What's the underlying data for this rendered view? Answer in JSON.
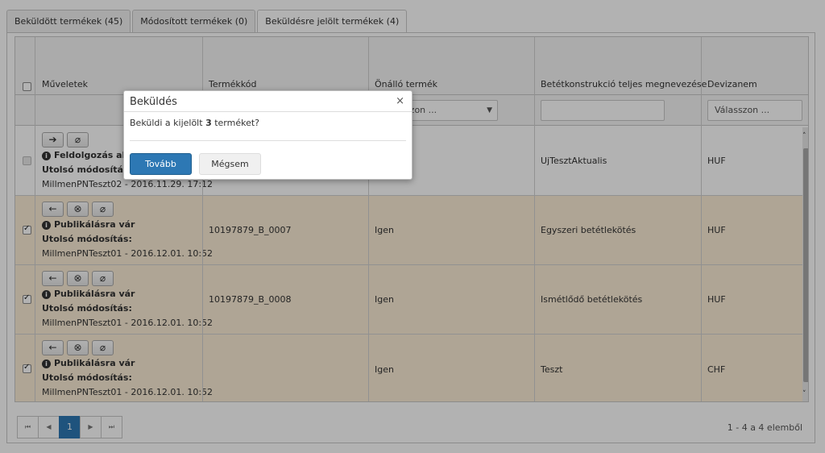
{
  "tabs": [
    {
      "label": "Beküldött termékek (45)"
    },
    {
      "label": "Módosított termékek (0)"
    },
    {
      "label": "Beküldésre jelölt termékek (4)"
    }
  ],
  "columns": {
    "actions": "Műveletek",
    "product_code": "Termékkód",
    "standalone": "Önálló termék",
    "full_name": "Betétkonstrukció teljes megnevezése",
    "currency": "Devizanem"
  },
  "filters": {
    "standalone_select": "Válasszon ...",
    "currency_select": "Válasszon ..."
  },
  "rows": [
    {
      "status": "Feldolgozás alatt",
      "modified_label": "Utolsó módosítás:",
      "modified_by": "MillmenPNTeszt02 - 2016.11.29. 17:12",
      "code": "",
      "standalone": "",
      "name": "UjTesztAktualis",
      "currency": "HUF",
      "checked": false
    },
    {
      "status": "Publikálásra vár",
      "modified_label": "Utolsó módosítás:",
      "modified_by": "MillmenPNTeszt01 - 2016.12.01. 10:52",
      "code": "10197879_B_0007",
      "standalone": "Igen",
      "name": "Egyszeri betétlekötés",
      "currency": "HUF",
      "checked": true
    },
    {
      "status": "Publikálásra vár",
      "modified_label": "Utolsó módosítás:",
      "modified_by": "MillmenPNTeszt01 - 2016.12.01. 10:52",
      "code": "10197879_B_0008",
      "standalone": "Igen",
      "name": "Ismétlődő betétlekötés",
      "currency": "HUF",
      "checked": true
    },
    {
      "status": "Publikálásra vár",
      "modified_label": "Utolsó módosítás:",
      "modified_by": "MillmenPNTeszt01 - 2016.12.01. 10:52",
      "code": "",
      "standalone": "Igen",
      "name": "Teszt",
      "currency": "CHF",
      "checked": true
    }
  ],
  "pager": {
    "first": "⏮",
    "prev": "◀",
    "current": "1",
    "next": "▶",
    "last": "⏭",
    "info": "1 - 4 a 4 elemből"
  },
  "dialog": {
    "title": "Beküldés",
    "close": "×",
    "message_pre": "Beküldi a kijelölt ",
    "message_count": "3",
    "message_post": " terméket?",
    "confirm": "Tovább",
    "cancel": "Mégsem"
  },
  "colors": {
    "primary": "#2d78b4",
    "row_highlight": "#fbedd6"
  }
}
